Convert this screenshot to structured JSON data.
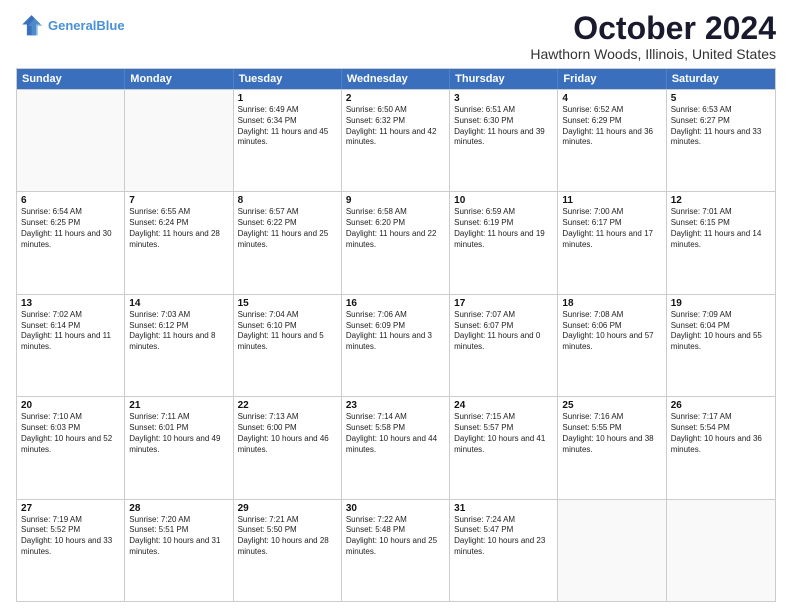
{
  "header": {
    "logo_line1": "General",
    "logo_line2": "Blue",
    "month": "October 2024",
    "location": "Hawthorn Woods, Illinois, United States"
  },
  "days_of_week": [
    "Sunday",
    "Monday",
    "Tuesday",
    "Wednesday",
    "Thursday",
    "Friday",
    "Saturday"
  ],
  "weeks": [
    [
      {
        "day": "",
        "sunrise": "",
        "sunset": "",
        "daylight": ""
      },
      {
        "day": "",
        "sunrise": "",
        "sunset": "",
        "daylight": ""
      },
      {
        "day": "1",
        "sunrise": "Sunrise: 6:49 AM",
        "sunset": "Sunset: 6:34 PM",
        "daylight": "Daylight: 11 hours and 45 minutes."
      },
      {
        "day": "2",
        "sunrise": "Sunrise: 6:50 AM",
        "sunset": "Sunset: 6:32 PM",
        "daylight": "Daylight: 11 hours and 42 minutes."
      },
      {
        "day": "3",
        "sunrise": "Sunrise: 6:51 AM",
        "sunset": "Sunset: 6:30 PM",
        "daylight": "Daylight: 11 hours and 39 minutes."
      },
      {
        "day": "4",
        "sunrise": "Sunrise: 6:52 AM",
        "sunset": "Sunset: 6:29 PM",
        "daylight": "Daylight: 11 hours and 36 minutes."
      },
      {
        "day": "5",
        "sunrise": "Sunrise: 6:53 AM",
        "sunset": "Sunset: 6:27 PM",
        "daylight": "Daylight: 11 hours and 33 minutes."
      }
    ],
    [
      {
        "day": "6",
        "sunrise": "Sunrise: 6:54 AM",
        "sunset": "Sunset: 6:25 PM",
        "daylight": "Daylight: 11 hours and 30 minutes."
      },
      {
        "day": "7",
        "sunrise": "Sunrise: 6:55 AM",
        "sunset": "Sunset: 6:24 PM",
        "daylight": "Daylight: 11 hours and 28 minutes."
      },
      {
        "day": "8",
        "sunrise": "Sunrise: 6:57 AM",
        "sunset": "Sunset: 6:22 PM",
        "daylight": "Daylight: 11 hours and 25 minutes."
      },
      {
        "day": "9",
        "sunrise": "Sunrise: 6:58 AM",
        "sunset": "Sunset: 6:20 PM",
        "daylight": "Daylight: 11 hours and 22 minutes."
      },
      {
        "day": "10",
        "sunrise": "Sunrise: 6:59 AM",
        "sunset": "Sunset: 6:19 PM",
        "daylight": "Daylight: 11 hours and 19 minutes."
      },
      {
        "day": "11",
        "sunrise": "Sunrise: 7:00 AM",
        "sunset": "Sunset: 6:17 PM",
        "daylight": "Daylight: 11 hours and 17 minutes."
      },
      {
        "day": "12",
        "sunrise": "Sunrise: 7:01 AM",
        "sunset": "Sunset: 6:15 PM",
        "daylight": "Daylight: 11 hours and 14 minutes."
      }
    ],
    [
      {
        "day": "13",
        "sunrise": "Sunrise: 7:02 AM",
        "sunset": "Sunset: 6:14 PM",
        "daylight": "Daylight: 11 hours and 11 minutes."
      },
      {
        "day": "14",
        "sunrise": "Sunrise: 7:03 AM",
        "sunset": "Sunset: 6:12 PM",
        "daylight": "Daylight: 11 hours and 8 minutes."
      },
      {
        "day": "15",
        "sunrise": "Sunrise: 7:04 AM",
        "sunset": "Sunset: 6:10 PM",
        "daylight": "Daylight: 11 hours and 5 minutes."
      },
      {
        "day": "16",
        "sunrise": "Sunrise: 7:06 AM",
        "sunset": "Sunset: 6:09 PM",
        "daylight": "Daylight: 11 hours and 3 minutes."
      },
      {
        "day": "17",
        "sunrise": "Sunrise: 7:07 AM",
        "sunset": "Sunset: 6:07 PM",
        "daylight": "Daylight: 11 hours and 0 minutes."
      },
      {
        "day": "18",
        "sunrise": "Sunrise: 7:08 AM",
        "sunset": "Sunset: 6:06 PM",
        "daylight": "Daylight: 10 hours and 57 minutes."
      },
      {
        "day": "19",
        "sunrise": "Sunrise: 7:09 AM",
        "sunset": "Sunset: 6:04 PM",
        "daylight": "Daylight: 10 hours and 55 minutes."
      }
    ],
    [
      {
        "day": "20",
        "sunrise": "Sunrise: 7:10 AM",
        "sunset": "Sunset: 6:03 PM",
        "daylight": "Daylight: 10 hours and 52 minutes."
      },
      {
        "day": "21",
        "sunrise": "Sunrise: 7:11 AM",
        "sunset": "Sunset: 6:01 PM",
        "daylight": "Daylight: 10 hours and 49 minutes."
      },
      {
        "day": "22",
        "sunrise": "Sunrise: 7:13 AM",
        "sunset": "Sunset: 6:00 PM",
        "daylight": "Daylight: 10 hours and 46 minutes."
      },
      {
        "day": "23",
        "sunrise": "Sunrise: 7:14 AM",
        "sunset": "Sunset: 5:58 PM",
        "daylight": "Daylight: 10 hours and 44 minutes."
      },
      {
        "day": "24",
        "sunrise": "Sunrise: 7:15 AM",
        "sunset": "Sunset: 5:57 PM",
        "daylight": "Daylight: 10 hours and 41 minutes."
      },
      {
        "day": "25",
        "sunrise": "Sunrise: 7:16 AM",
        "sunset": "Sunset: 5:55 PM",
        "daylight": "Daylight: 10 hours and 38 minutes."
      },
      {
        "day": "26",
        "sunrise": "Sunrise: 7:17 AM",
        "sunset": "Sunset: 5:54 PM",
        "daylight": "Daylight: 10 hours and 36 minutes."
      }
    ],
    [
      {
        "day": "27",
        "sunrise": "Sunrise: 7:19 AM",
        "sunset": "Sunset: 5:52 PM",
        "daylight": "Daylight: 10 hours and 33 minutes."
      },
      {
        "day": "28",
        "sunrise": "Sunrise: 7:20 AM",
        "sunset": "Sunset: 5:51 PM",
        "daylight": "Daylight: 10 hours and 31 minutes."
      },
      {
        "day": "29",
        "sunrise": "Sunrise: 7:21 AM",
        "sunset": "Sunset: 5:50 PM",
        "daylight": "Daylight: 10 hours and 28 minutes."
      },
      {
        "day": "30",
        "sunrise": "Sunrise: 7:22 AM",
        "sunset": "Sunset: 5:48 PM",
        "daylight": "Daylight: 10 hours and 25 minutes."
      },
      {
        "day": "31",
        "sunrise": "Sunrise: 7:24 AM",
        "sunset": "Sunset: 5:47 PM",
        "daylight": "Daylight: 10 hours and 23 minutes."
      },
      {
        "day": "",
        "sunrise": "",
        "sunset": "",
        "daylight": ""
      },
      {
        "day": "",
        "sunrise": "",
        "sunset": "",
        "daylight": ""
      }
    ]
  ]
}
